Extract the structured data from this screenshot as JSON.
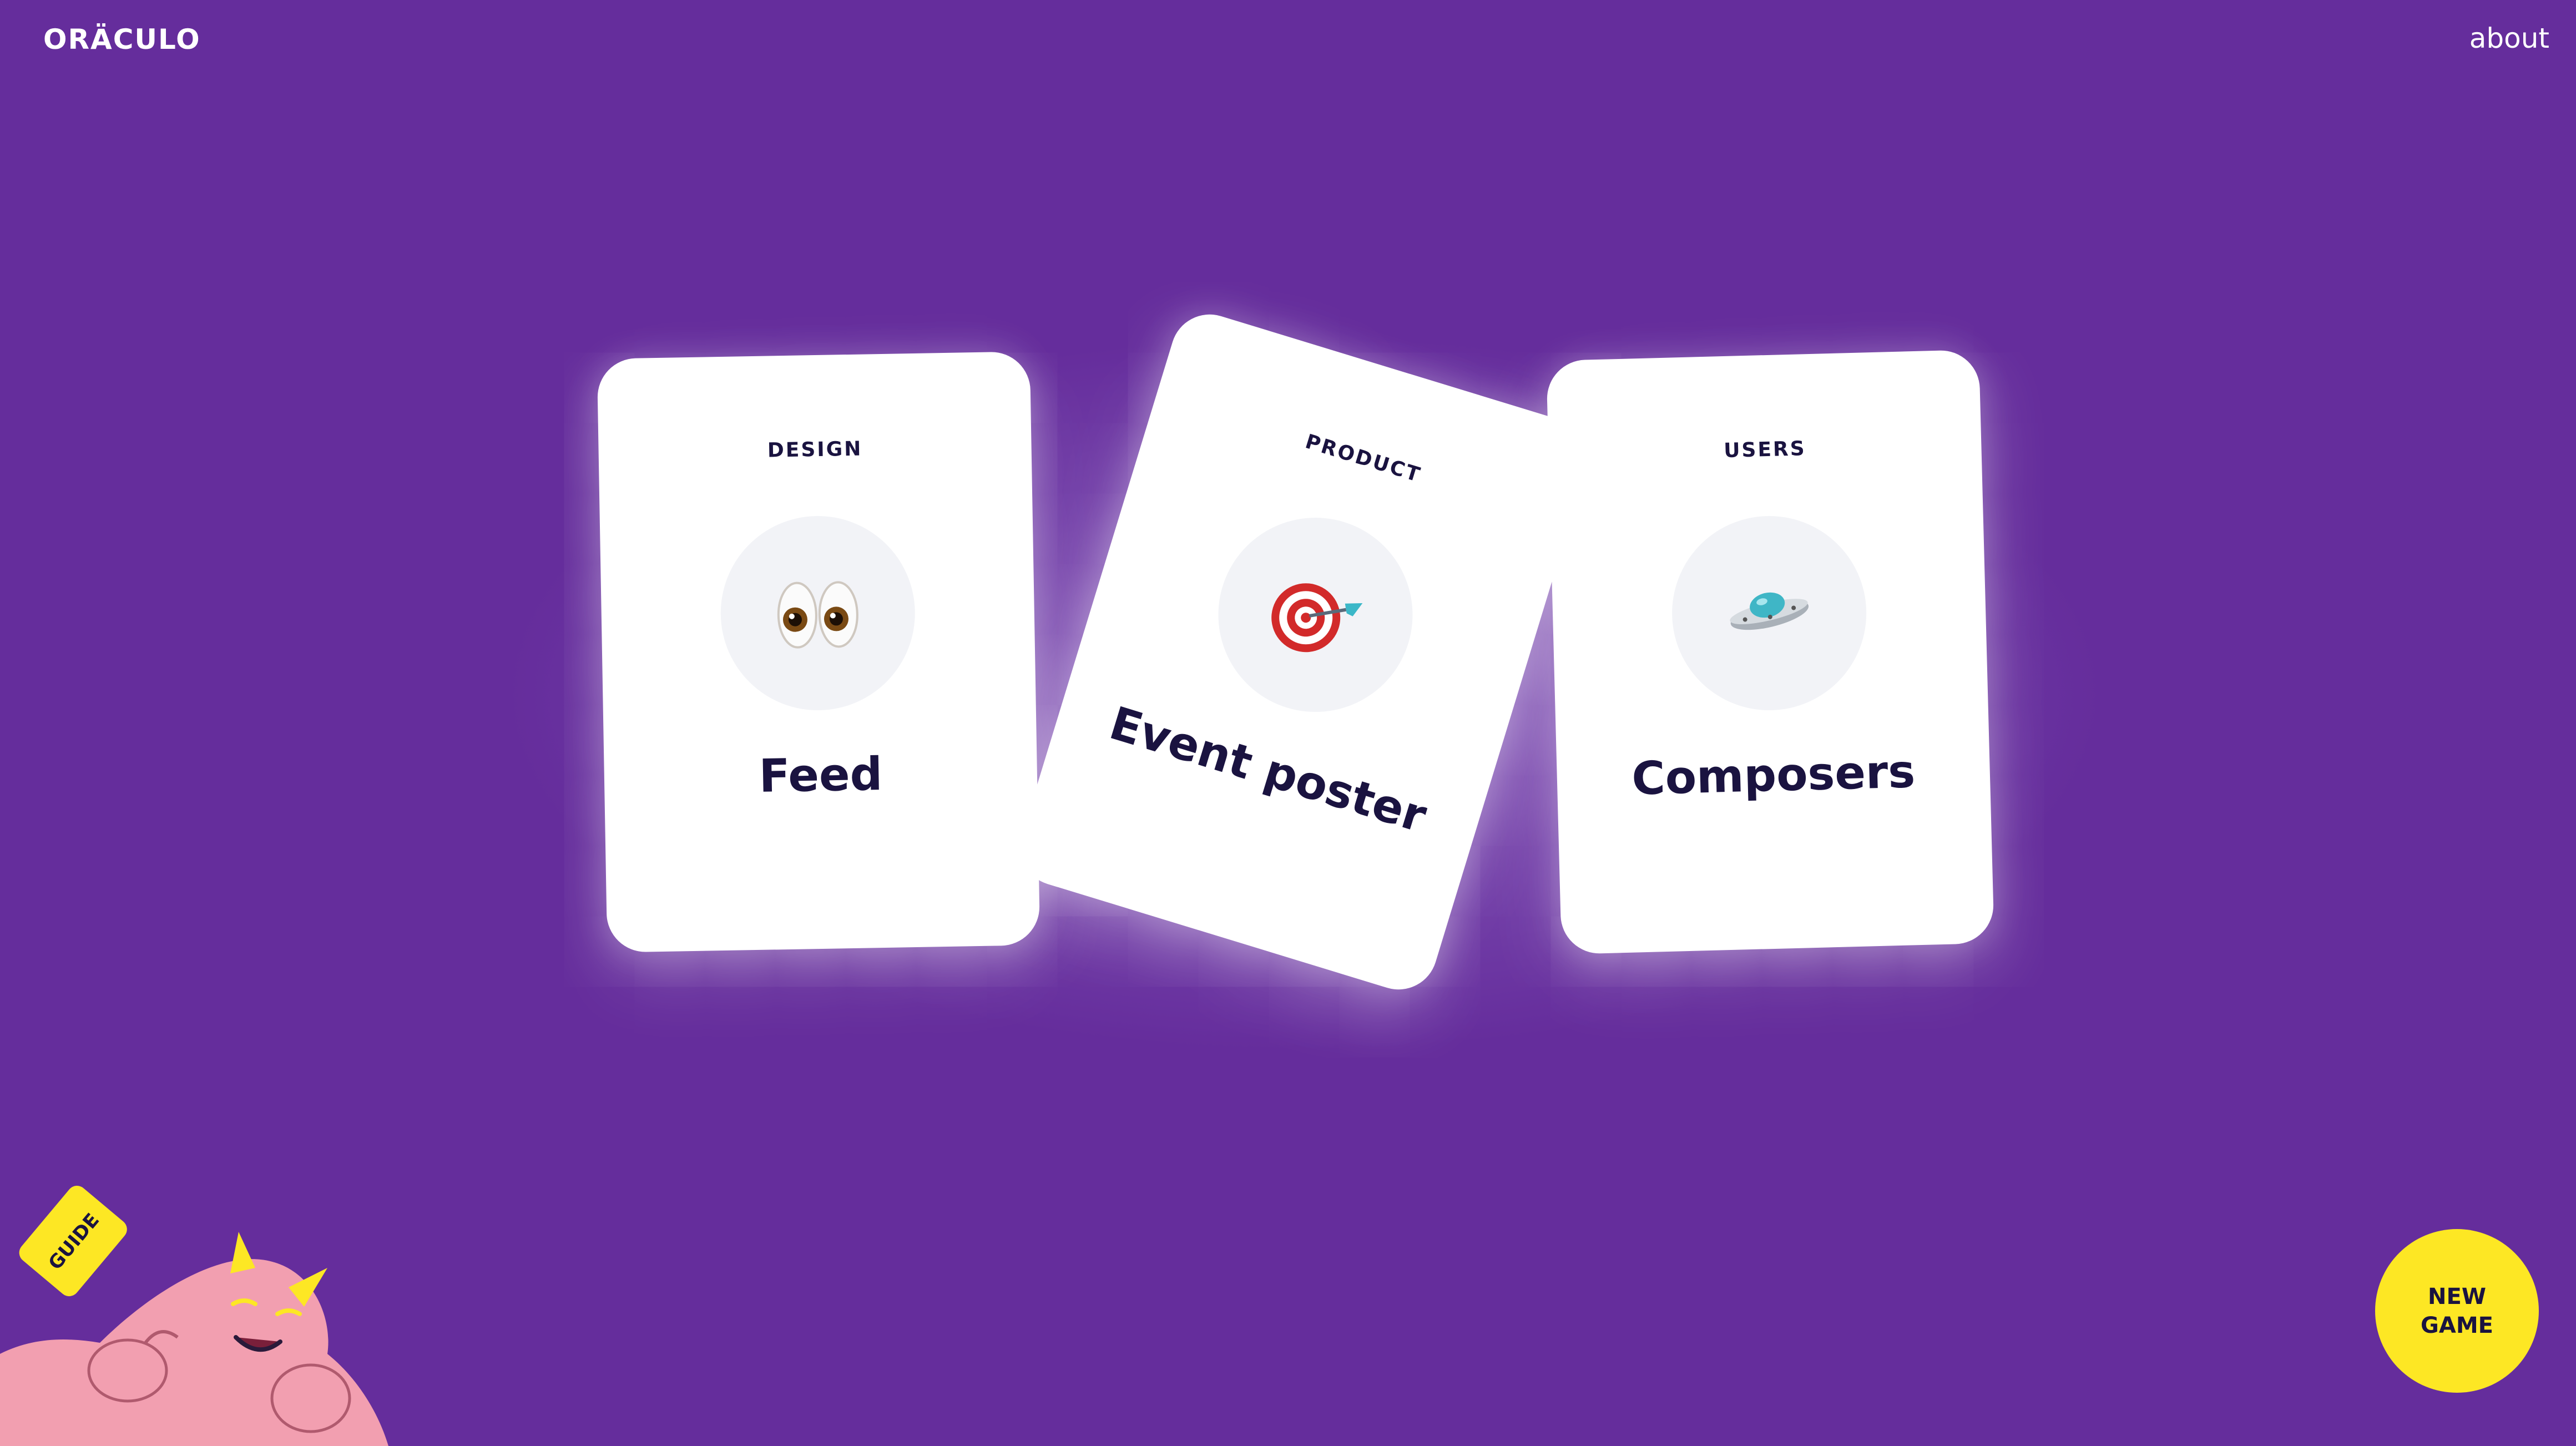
{
  "header": {
    "logo": "ORÄCULO",
    "about_label": "about"
  },
  "cards": [
    {
      "category": "DESIGN",
      "title": "Feed",
      "icon": "eyes-icon"
    },
    {
      "category": "PRODUCT",
      "title": "Event poster",
      "icon": "target-dart-icon"
    },
    {
      "category": "USERS",
      "title": "Composers",
      "icon": "ufo-icon"
    }
  ],
  "new_game": {
    "line1": "NEW",
    "line2": "GAME"
  },
  "guide": {
    "label": "GUIDE"
  },
  "colors": {
    "background": "#652d9c",
    "card": "#ffffff",
    "text_dark": "#1a1340",
    "accent_yellow": "#fde724",
    "mascot_pink": "#f29fb0"
  }
}
